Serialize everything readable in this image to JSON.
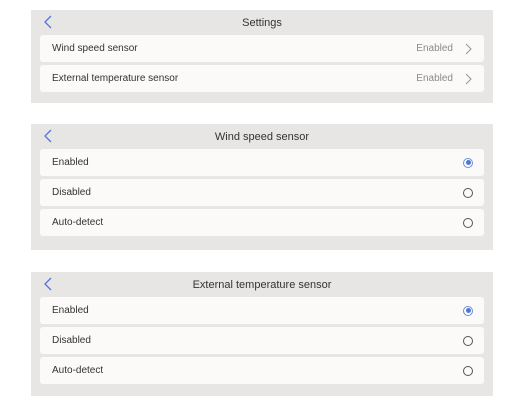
{
  "colors": {
    "panel_bg": "#e8e6e4",
    "row_bg": "#fbfaf8",
    "accent": "#4d78d8",
    "back_arrow": "#4d78d8"
  },
  "icons": {
    "back": "chevron-left-icon",
    "next": "chevron-right-icon",
    "radio": "radio-button-icon"
  },
  "settings": {
    "title": "Settings",
    "items": [
      {
        "label": "Wind speed sensor",
        "value": "Enabled"
      },
      {
        "label": "External temperature sensor",
        "value": "Enabled"
      }
    ]
  },
  "wind": {
    "title": "Wind speed sensor",
    "options": [
      {
        "label": "Enabled",
        "selected": true
      },
      {
        "label": "Disabled",
        "selected": false
      },
      {
        "label": "Auto-detect",
        "selected": false
      }
    ]
  },
  "temp": {
    "title": "External temperature sensor",
    "options": [
      {
        "label": "Enabled",
        "selected": true
      },
      {
        "label": "Disabled",
        "selected": false
      },
      {
        "label": "Auto-detect",
        "selected": false
      }
    ]
  }
}
